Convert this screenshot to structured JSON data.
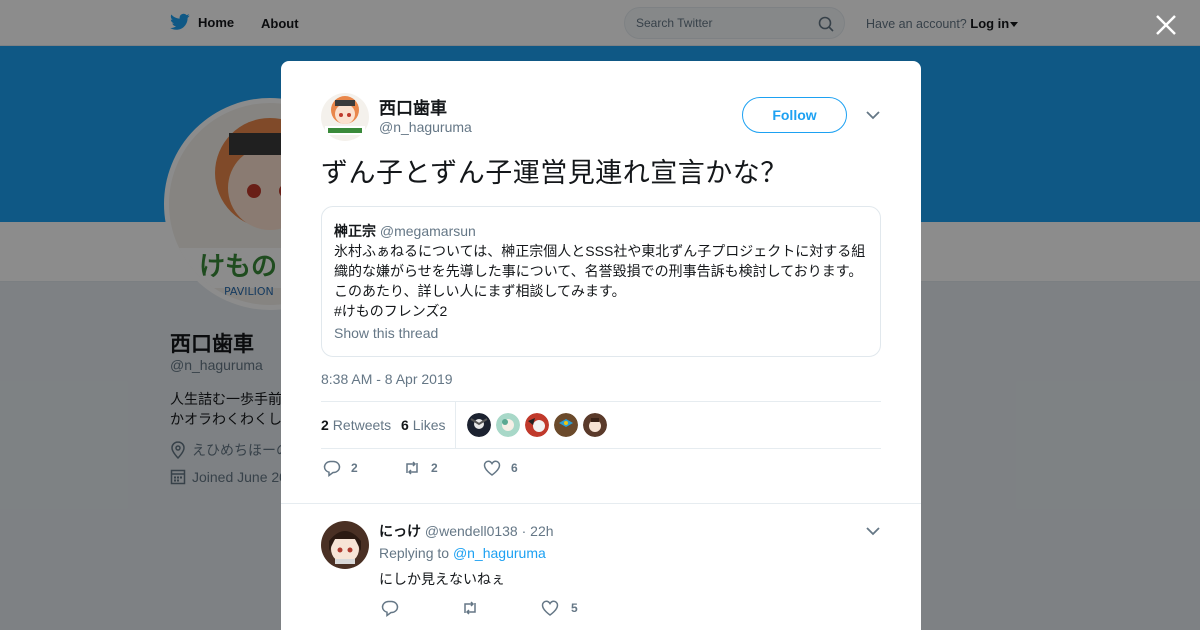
{
  "topbar": {
    "home_label": "Home",
    "about_label": "About",
    "search_placeholder": "Search Twitter",
    "account_prompt": "Have an account?",
    "login_label": "Log in"
  },
  "profile": {
    "name": "西口歯車",
    "handle": "@n_haguruma",
    "bio_line1": "人生詰む一歩手前",
    "bio_line2": "かオラわくわくし",
    "location": "えひめちほーの",
    "joined": "Joined June 20"
  },
  "colors": {
    "accent": "#1da1f2",
    "banner": "#1da1f2",
    "text_primary": "#14171a",
    "text_secondary": "#657786"
  },
  "tweet": {
    "author_name": "西口歯車",
    "author_handle": "@n_haguruma",
    "follow_label": "Follow",
    "text": "ずん子とずん子運営見連れ宣言かな？",
    "quote": {
      "name": "榊正宗",
      "handle": "@megamarsun",
      "body": "氷村ふぁねるについては、榊正宗個人とSSS社や東北ずん子プロジェクトに対する組織的な嫌がらせを先導した事について、名誉毀損での刑事告訴も検討しております。このあたり、詳しい人にまず相談してみます。",
      "hashtag": "#けものフレンズ2",
      "show_thread": "Show this thread"
    },
    "timestamp": "8:38 AM - 8 Apr 2019",
    "retweets_count": "2",
    "retweets_label": "Retweets",
    "likes_count": "6",
    "likes_label": "Likes",
    "actions": {
      "reply_count": "2",
      "retweet_count": "2",
      "like_count": "6"
    }
  },
  "reply": {
    "name": "にっけ",
    "handle": "@wendell0138",
    "time": "· 22h",
    "replying_prefix": "Replying to",
    "replying_to": "@n_haguruma",
    "text": "にしか見えないねぇ",
    "like_count": "5"
  }
}
